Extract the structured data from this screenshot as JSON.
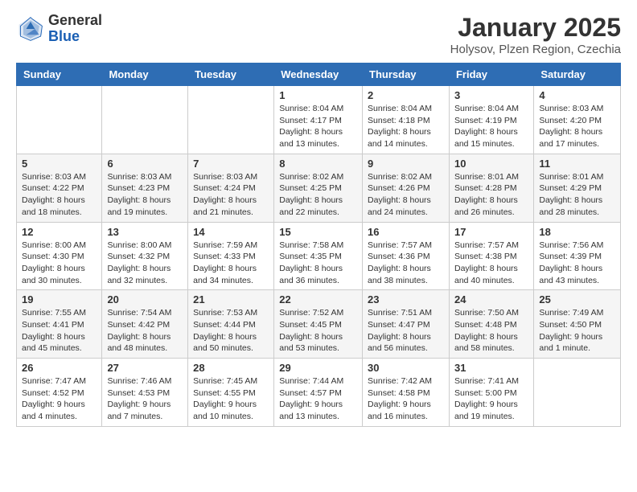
{
  "header": {
    "logo_general": "General",
    "logo_blue": "Blue",
    "month_title": "January 2025",
    "location": "Holysov, Plzen Region, Czechia"
  },
  "days_of_week": [
    "Sunday",
    "Monday",
    "Tuesday",
    "Wednesday",
    "Thursday",
    "Friday",
    "Saturday"
  ],
  "weeks": [
    [
      {
        "day": "",
        "info": ""
      },
      {
        "day": "",
        "info": ""
      },
      {
        "day": "",
        "info": ""
      },
      {
        "day": "1",
        "info": "Sunrise: 8:04 AM\nSunset: 4:17 PM\nDaylight: 8 hours\nand 13 minutes."
      },
      {
        "day": "2",
        "info": "Sunrise: 8:04 AM\nSunset: 4:18 PM\nDaylight: 8 hours\nand 14 minutes."
      },
      {
        "day": "3",
        "info": "Sunrise: 8:04 AM\nSunset: 4:19 PM\nDaylight: 8 hours\nand 15 minutes."
      },
      {
        "day": "4",
        "info": "Sunrise: 8:03 AM\nSunset: 4:20 PM\nDaylight: 8 hours\nand 17 minutes."
      }
    ],
    [
      {
        "day": "5",
        "info": "Sunrise: 8:03 AM\nSunset: 4:22 PM\nDaylight: 8 hours\nand 18 minutes."
      },
      {
        "day": "6",
        "info": "Sunrise: 8:03 AM\nSunset: 4:23 PM\nDaylight: 8 hours\nand 19 minutes."
      },
      {
        "day": "7",
        "info": "Sunrise: 8:03 AM\nSunset: 4:24 PM\nDaylight: 8 hours\nand 21 minutes."
      },
      {
        "day": "8",
        "info": "Sunrise: 8:02 AM\nSunset: 4:25 PM\nDaylight: 8 hours\nand 22 minutes."
      },
      {
        "day": "9",
        "info": "Sunrise: 8:02 AM\nSunset: 4:26 PM\nDaylight: 8 hours\nand 24 minutes."
      },
      {
        "day": "10",
        "info": "Sunrise: 8:01 AM\nSunset: 4:28 PM\nDaylight: 8 hours\nand 26 minutes."
      },
      {
        "day": "11",
        "info": "Sunrise: 8:01 AM\nSunset: 4:29 PM\nDaylight: 8 hours\nand 28 minutes."
      }
    ],
    [
      {
        "day": "12",
        "info": "Sunrise: 8:00 AM\nSunset: 4:30 PM\nDaylight: 8 hours\nand 30 minutes."
      },
      {
        "day": "13",
        "info": "Sunrise: 8:00 AM\nSunset: 4:32 PM\nDaylight: 8 hours\nand 32 minutes."
      },
      {
        "day": "14",
        "info": "Sunrise: 7:59 AM\nSunset: 4:33 PM\nDaylight: 8 hours\nand 34 minutes."
      },
      {
        "day": "15",
        "info": "Sunrise: 7:58 AM\nSunset: 4:35 PM\nDaylight: 8 hours\nand 36 minutes."
      },
      {
        "day": "16",
        "info": "Sunrise: 7:57 AM\nSunset: 4:36 PM\nDaylight: 8 hours\nand 38 minutes."
      },
      {
        "day": "17",
        "info": "Sunrise: 7:57 AM\nSunset: 4:38 PM\nDaylight: 8 hours\nand 40 minutes."
      },
      {
        "day": "18",
        "info": "Sunrise: 7:56 AM\nSunset: 4:39 PM\nDaylight: 8 hours\nand 43 minutes."
      }
    ],
    [
      {
        "day": "19",
        "info": "Sunrise: 7:55 AM\nSunset: 4:41 PM\nDaylight: 8 hours\nand 45 minutes."
      },
      {
        "day": "20",
        "info": "Sunrise: 7:54 AM\nSunset: 4:42 PM\nDaylight: 8 hours\nand 48 minutes."
      },
      {
        "day": "21",
        "info": "Sunrise: 7:53 AM\nSunset: 4:44 PM\nDaylight: 8 hours\nand 50 minutes."
      },
      {
        "day": "22",
        "info": "Sunrise: 7:52 AM\nSunset: 4:45 PM\nDaylight: 8 hours\nand 53 minutes."
      },
      {
        "day": "23",
        "info": "Sunrise: 7:51 AM\nSunset: 4:47 PM\nDaylight: 8 hours\nand 56 minutes."
      },
      {
        "day": "24",
        "info": "Sunrise: 7:50 AM\nSunset: 4:48 PM\nDaylight: 8 hours\nand 58 minutes."
      },
      {
        "day": "25",
        "info": "Sunrise: 7:49 AM\nSunset: 4:50 PM\nDaylight: 9 hours\nand 1 minute."
      }
    ],
    [
      {
        "day": "26",
        "info": "Sunrise: 7:47 AM\nSunset: 4:52 PM\nDaylight: 9 hours\nand 4 minutes."
      },
      {
        "day": "27",
        "info": "Sunrise: 7:46 AM\nSunset: 4:53 PM\nDaylight: 9 hours\nand 7 minutes."
      },
      {
        "day": "28",
        "info": "Sunrise: 7:45 AM\nSunset: 4:55 PM\nDaylight: 9 hours\nand 10 minutes."
      },
      {
        "day": "29",
        "info": "Sunrise: 7:44 AM\nSunset: 4:57 PM\nDaylight: 9 hours\nand 13 minutes."
      },
      {
        "day": "30",
        "info": "Sunrise: 7:42 AM\nSunset: 4:58 PM\nDaylight: 9 hours\nand 16 minutes."
      },
      {
        "day": "31",
        "info": "Sunrise: 7:41 AM\nSunset: 5:00 PM\nDaylight: 9 hours\nand 19 minutes."
      },
      {
        "day": "",
        "info": ""
      }
    ]
  ]
}
